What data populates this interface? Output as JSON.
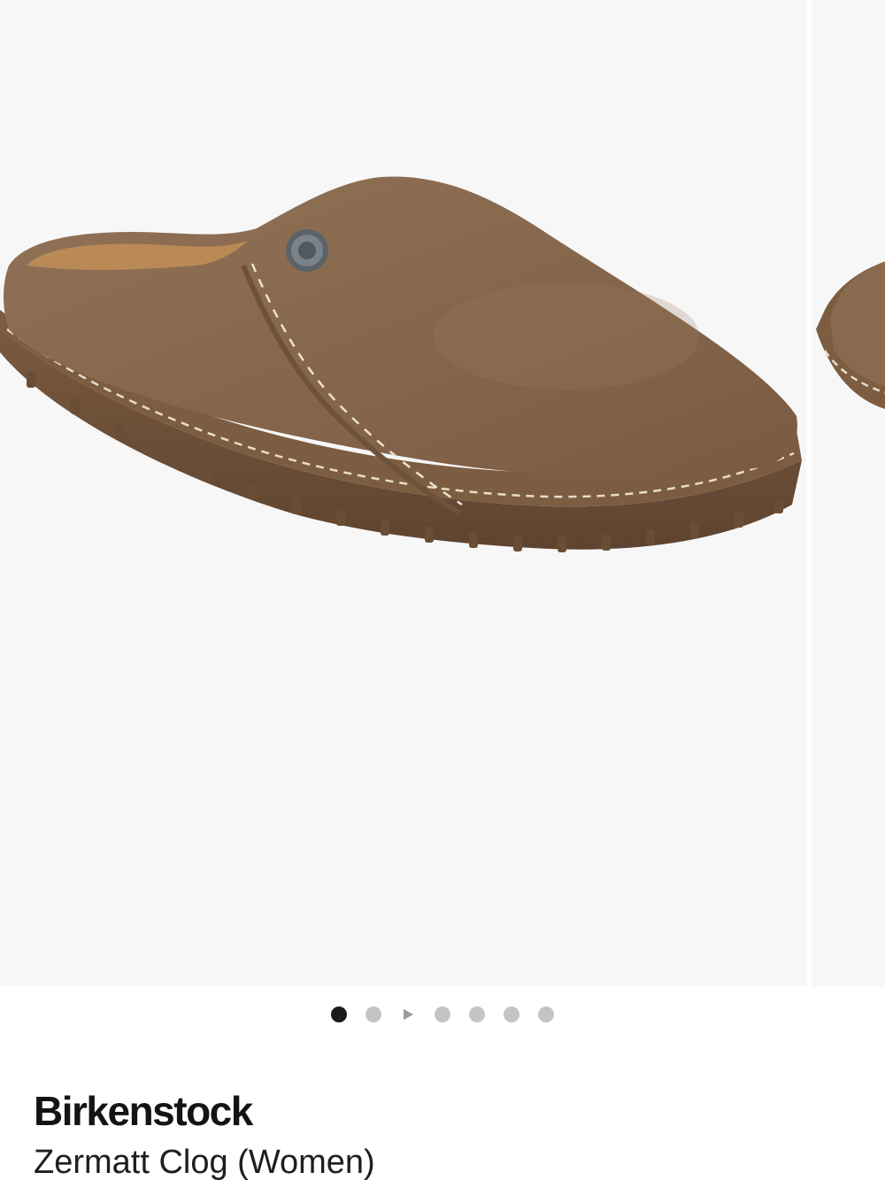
{
  "product": {
    "brand": "Birkenstock",
    "name": "Zermatt Clog (Women)"
  },
  "gallery": {
    "images": [
      {
        "icon": "product-image-clog-side",
        "color": "#8a6a4e"
      },
      {
        "icon": "product-image-clog-partial"
      }
    ],
    "dots": [
      {
        "type": "image",
        "active": true
      },
      {
        "type": "image",
        "active": false
      },
      {
        "type": "video",
        "active": false
      },
      {
        "type": "image",
        "active": false
      },
      {
        "type": "image",
        "active": false
      },
      {
        "type": "image",
        "active": false
      },
      {
        "type": "image",
        "active": false
      }
    ]
  },
  "colors": {
    "background": "#f7f7f8",
    "suede": "#8a6a4e",
    "sole": "#6e5038",
    "dot_active": "#1a1a1a",
    "dot_inactive": "#c4c4c4"
  }
}
